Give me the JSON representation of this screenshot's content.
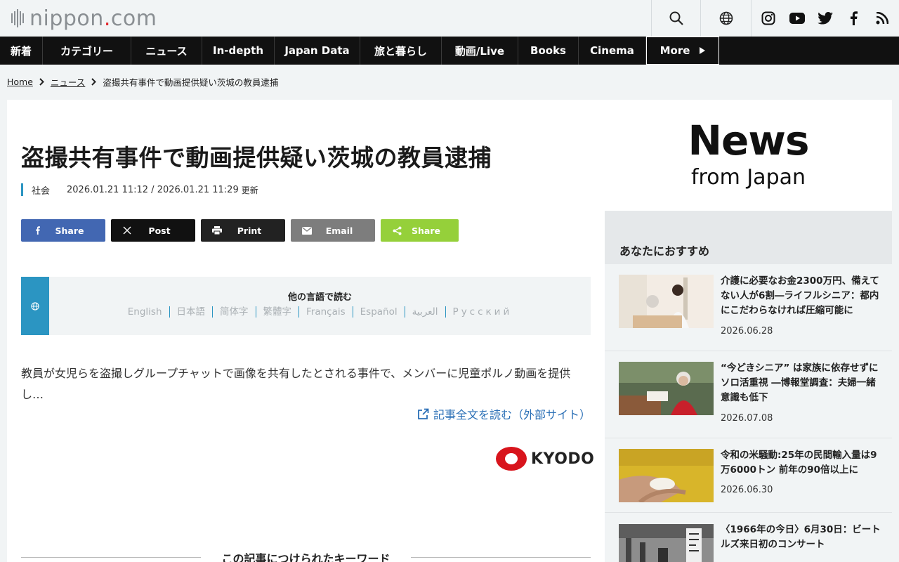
{
  "header": {
    "logo_main": "nippon",
    "logo_dot": ".",
    "logo_tld": "com",
    "icons": [
      "search-icon",
      "globe-icon"
    ],
    "social": [
      "instagram-icon",
      "youtube-icon",
      "twitter-icon",
      "facebook-icon",
      "rss-icon"
    ]
  },
  "nav": {
    "items": [
      "新着",
      "カテゴリー",
      "ニュース",
      "In-depth",
      "Japan Data",
      "旅と暮らし",
      "動画/Live",
      "Books",
      "Cinema"
    ],
    "more": "More"
  },
  "breadcrumb": {
    "home": "Home",
    "section": "ニュース",
    "current": "盗撮共有事件で動画提供疑い茨城の教員逮捕"
  },
  "article": {
    "title": "盗撮共有事件で動画提供疑い茨城の教員逮捕",
    "category": "社会",
    "dates": "2026.01.21 11:12 / 2026.01.21 11:29",
    "updated_label": "更新",
    "share_buttons": [
      {
        "label": "Share",
        "icon": "facebook-icon",
        "color": "#4267b2"
      },
      {
        "label": "Post",
        "icon": "x-icon",
        "color": "#111111"
      },
      {
        "label": "Print",
        "icon": "print-icon",
        "color": "#222222"
      },
      {
        "label": "Email",
        "icon": "email-icon",
        "color": "#7d7d7d"
      },
      {
        "label": "Share",
        "icon": "share-icon",
        "color": "#95d03a"
      }
    ],
    "languages_title": "他の言語で読む",
    "languages": [
      "English",
      "日本語",
      "简体字",
      "繁體字",
      "Français",
      "Español",
      "العربية",
      "Русский"
    ],
    "lede": "教員が女児らを盗撮しグループチャットで画像を共有したとされる事件で、メンバーに児童ポルノ動画を提供し…",
    "read_full": "記事全文を読む（外部サイト）",
    "source": "KYODO",
    "keywords_title": "この記事につけられたキーワード"
  },
  "sidebar": {
    "banner_title": "News",
    "banner_subtitle": "from Japan",
    "recommend_title": "あなたにおすすめ",
    "items": [
      {
        "title": "介護に必要なお金2300万円、備えてない人が6割―ライフルシニア：都内にこだわらなければ圧縮可能に",
        "date": "2026.06.28"
      },
      {
        "title": "“今どきシニア” は家族に依存せずにソロ活重視 ―博報堂調査：夫婦一緒意識も低下",
        "date": "2026.07.08"
      },
      {
        "title": "令和の米騒動:25年の民間輸入量は9万6000トン 前年の90倍以上に",
        "date": "2026.06.30"
      },
      {
        "title": "〈1966年の今日〉6月30日：ビートルズ来日初のコンサート",
        "date": ""
      }
    ]
  },
  "colors": {
    "accent": "#2b95c2",
    "nav_bg": "#111111",
    "brand_red": "#e3262b",
    "link": "#2a6fb6"
  }
}
